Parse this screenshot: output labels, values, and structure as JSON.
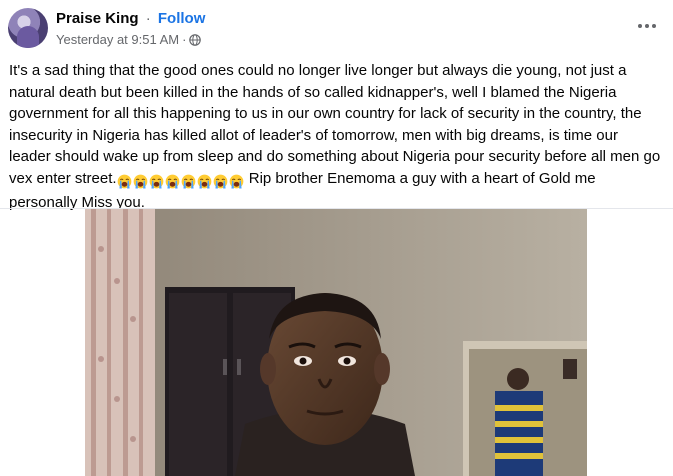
{
  "post": {
    "author": "Praise King",
    "separator": "·",
    "follow_label": "Follow",
    "timestamp": "Yesterday at 9:51 AM",
    "meta_separator": "·",
    "audience_icon": "globe-icon",
    "more_icon": "more-options-icon",
    "text_before_emojis": "It's a sad thing that the good ones could no longer live longer but always die young, not just a natural death but been killed in the hands of so called kidnapper's, well I blamed the Nigeria government for all this happening to us in our own country for lack of security in the country, the insecurity in Nigeria has killed allot of leader's of tomorrow, men with big dreams, is time our leader should wake up from sleep and do something about Nigeria pour security before all men go vex enter street.",
    "emojis": [
      "loudly-crying-face-icon",
      "loudly-crying-face-icon",
      "loudly-crying-face-icon",
      "loudly-crying-face-icon",
      "loudly-crying-face-icon",
      "loudly-crying-face-icon",
      "loudly-crying-face-icon",
      "loudly-crying-face-icon"
    ],
    "text_after_emojis": " Rip brother Enemoma a guy with a heart of Gold me personally Miss you."
  },
  "colors": {
    "follow": "#1b74e4",
    "meta_text": "#65676b",
    "body_text": "#050505"
  }
}
